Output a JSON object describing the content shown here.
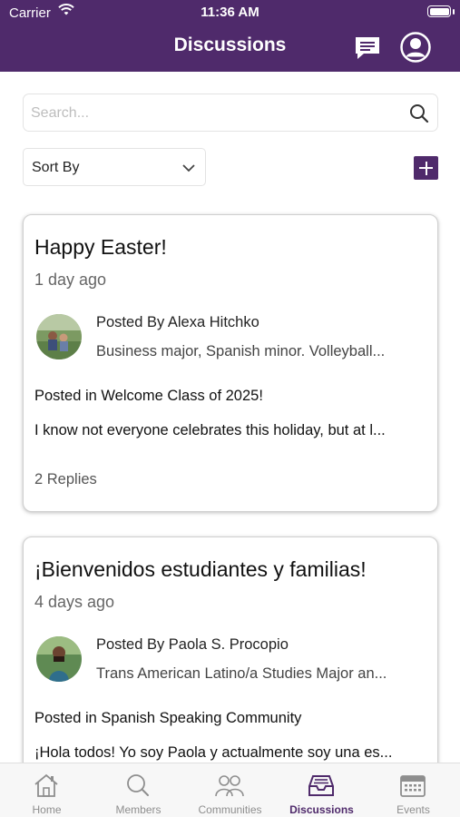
{
  "status_bar": {
    "carrier": "Carrier",
    "time": "11:36 AM"
  },
  "header": {
    "title": "Discussions",
    "icons": [
      "chat-icon",
      "profile-icon"
    ]
  },
  "search": {
    "placeholder": "Search...",
    "value": ""
  },
  "sort": {
    "label": "Sort By"
  },
  "posts": [
    {
      "title": "Happy Easter!",
      "age": "1 day ago",
      "posted_by": "Posted By Alexa Hitchko",
      "bio": "Business major, Spanish minor. Volleyball...",
      "community": "Posted in Welcome Class of 2025!",
      "excerpt": "I know not everyone celebrates this holiday, but at l...",
      "replies": "2 Replies"
    },
    {
      "title": "¡Bienvenidos estudiantes y familias!",
      "age": "4 days ago",
      "posted_by": "Posted By Paola S. Procopio",
      "bio": "Trans American Latino/a Studies Major an...",
      "community": "Posted in Spanish Speaking Community",
      "excerpt": "¡Hola todos! Yo soy Paola y actualmente soy una es..."
    }
  ],
  "tabbar": {
    "tabs": [
      {
        "label": "Home",
        "icon": "home-icon"
      },
      {
        "label": "Members",
        "icon": "search-icon"
      },
      {
        "label": "Communities",
        "icon": "people-icon"
      },
      {
        "label": "Discussions",
        "icon": "inbox-icon",
        "active": true
      },
      {
        "label": "Events",
        "icon": "calendar-icon"
      }
    ]
  },
  "colors": {
    "brand": "#4f2a6b",
    "tab_inactive": "#8e8e8e"
  }
}
